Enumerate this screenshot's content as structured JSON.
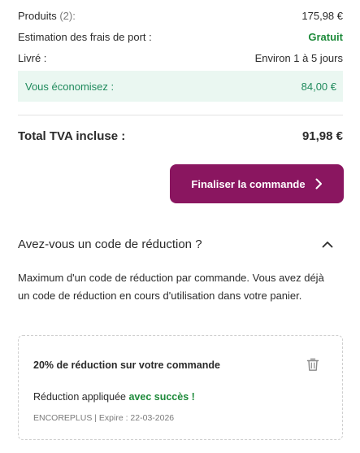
{
  "summary": {
    "products_label": "Produits",
    "products_count": "(2):",
    "products_value": "175,98 €",
    "shipping_label": "Estimation des frais de port :",
    "shipping_value": "Gratuit",
    "delivered_label": "Livré :",
    "delivered_value": "Environ 1 à 5 jours",
    "savings_label": "Vous économisez :",
    "savings_value": "84,00 €",
    "total_label": "Total TVA incluse :",
    "total_value": "91,98 €"
  },
  "checkout": {
    "label": "Finaliser la commande",
    "icon": "chevron-right-icon"
  },
  "promo": {
    "heading": "Avez-vous un code de réduction ?",
    "toggle_icon": "chevron-up-icon",
    "description": "Maximum d'un code de réduction par commande. Vous avez déjà un code de réduction en cours d'utilisation dans votre panier.",
    "coupon": {
      "title": "20% de réduction sur votre commande",
      "applied_prefix": "Réduction appliquée",
      "applied_status": "avec succès !",
      "meta": "ENCOREPLUS | Expire : 22-03-2026",
      "delete_icon": "trash-icon"
    }
  },
  "colors": {
    "accent": "#8a1660",
    "success": "#1d8a3a",
    "savings_bg": "#eaf7f1",
    "savings_text": "#1f8a5c"
  }
}
